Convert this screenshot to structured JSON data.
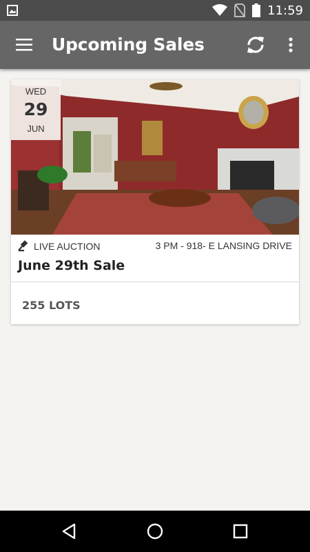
{
  "status_bar": {
    "time": "11:59"
  },
  "app_bar": {
    "title": "Upcoming Sales"
  },
  "sale": {
    "date": {
      "weekday": "WED",
      "day": "29",
      "month": "JUN"
    },
    "type": "LIVE AUCTION",
    "when_where": "3 PM - 918- E LANSING DRIVE",
    "title": "June 29th Sale",
    "lots": "255 LOTS"
  },
  "colors": {
    "status_bar": "#4c4c4c",
    "app_bar": "#666666",
    "background": "#f4f3f0"
  },
  "icons": [
    "gallery-icon",
    "wifi-icon",
    "no-sim-icon",
    "battery-icon",
    "menu-icon",
    "refresh-icon",
    "more-vert-icon",
    "gavel-icon",
    "back-icon",
    "home-icon",
    "recents-icon"
  ]
}
